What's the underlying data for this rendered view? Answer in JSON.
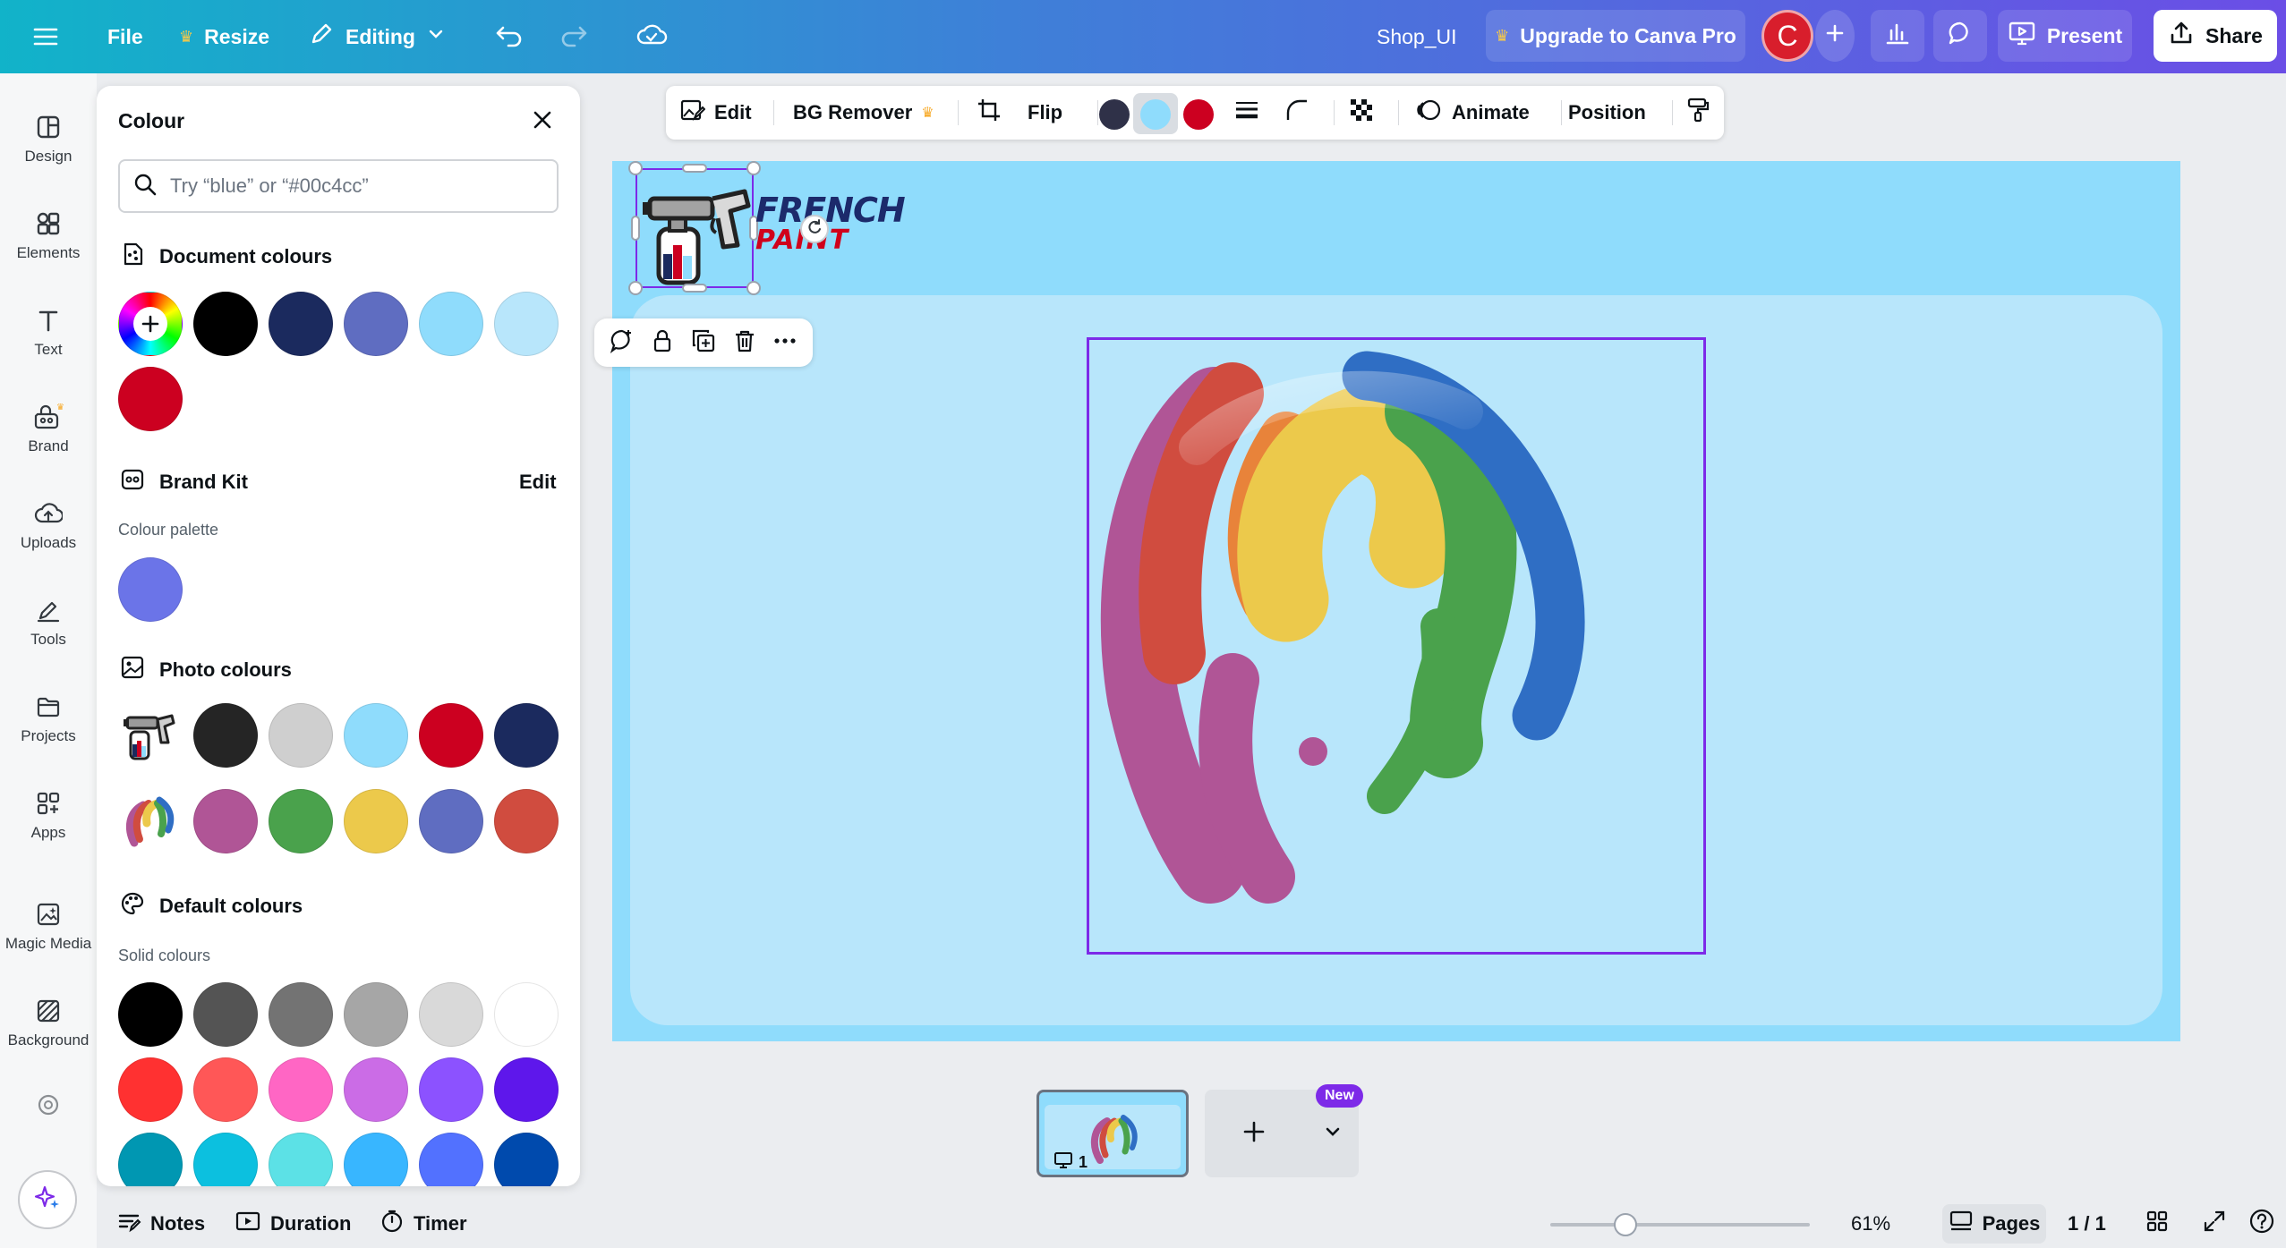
{
  "topbar": {
    "file": "File",
    "resize": "Resize",
    "editing": "Editing",
    "doc_title": "Shop_UI",
    "upgrade": "Upgrade to Canva Pro",
    "avatar_initial": "C",
    "present": "Present",
    "share": "Share"
  },
  "rail": {
    "items": [
      {
        "label": "Design",
        "icon": "design-icon"
      },
      {
        "label": "Elements",
        "icon": "elements-icon"
      },
      {
        "label": "Text",
        "icon": "text-icon"
      },
      {
        "label": "Brand",
        "icon": "brand-icon"
      },
      {
        "label": "Uploads",
        "icon": "uploads-icon"
      },
      {
        "label": "Tools",
        "icon": "tools-icon"
      },
      {
        "label": "Projects",
        "icon": "projects-icon"
      },
      {
        "label": "Apps",
        "icon": "apps-icon"
      },
      {
        "label": "Magic Media",
        "icon": "magic-media-icon"
      },
      {
        "label": "Background",
        "icon": "background-icon"
      }
    ]
  },
  "panel": {
    "title": "Colour",
    "search_placeholder": "Try “blue” or “#00c4cc”",
    "document_colours": {
      "heading": "Document colours",
      "swatches": [
        "#000000",
        "#1b2a5e",
        "#5f6dc1",
        "#8fdcfc",
        "#b8e6fb",
        "#cc0020"
      ]
    },
    "brand_kit": {
      "heading": "Brand Kit",
      "edit": "Edit",
      "palette_label": "Colour palette",
      "swatches": [
        "#6b74e8"
      ]
    },
    "photo_colours": {
      "heading": "Photo colours",
      "row1": [
        "#252525",
        "#cfcfcf",
        "#8fdcfc",
        "#cc0020",
        "#1b2a5e"
      ],
      "row2": [
        "#b05596",
        "#4aa24c",
        "#ecc94b",
        "#5f6dc1",
        "#d04c3f"
      ]
    },
    "default_colours": {
      "heading": "Default colours",
      "solid_label": "Solid colours",
      "row1": [
        "#000000",
        "#545454",
        "#737373",
        "#a6a6a6",
        "#d9d9d9",
        "#ffffff"
      ],
      "row2": [
        "#ff3131",
        "#ff5757",
        "#ff66c4",
        "#cb6ce6",
        "#8c52ff",
        "#5e17eb"
      ],
      "row3": [
        "#0097b2",
        "#0cc0df",
        "#5ce1e6",
        "#38b6ff",
        "#5271ff",
        "#004aad"
      ]
    }
  },
  "context_toolbar": {
    "edit": "Edit",
    "bg_remover": "BG Remover",
    "flip": "Flip",
    "colors": [
      "#2f3148",
      "#8fdcfc",
      "#cc0020"
    ],
    "animate": "Animate",
    "position": "Position"
  },
  "canvas": {
    "background": "#8fdcfc",
    "card": "#b8e6fb",
    "brand_line1": "FRENCH",
    "brand_line2": "PAINT"
  },
  "pages": {
    "thumb_number": "1",
    "new_badge": "New"
  },
  "bottombar": {
    "notes": "Notes",
    "duration": "Duration",
    "timer": "Timer",
    "zoom": "61%",
    "zoom_fraction": 0.29,
    "pages": "Pages",
    "page_count": "1 / 1"
  }
}
